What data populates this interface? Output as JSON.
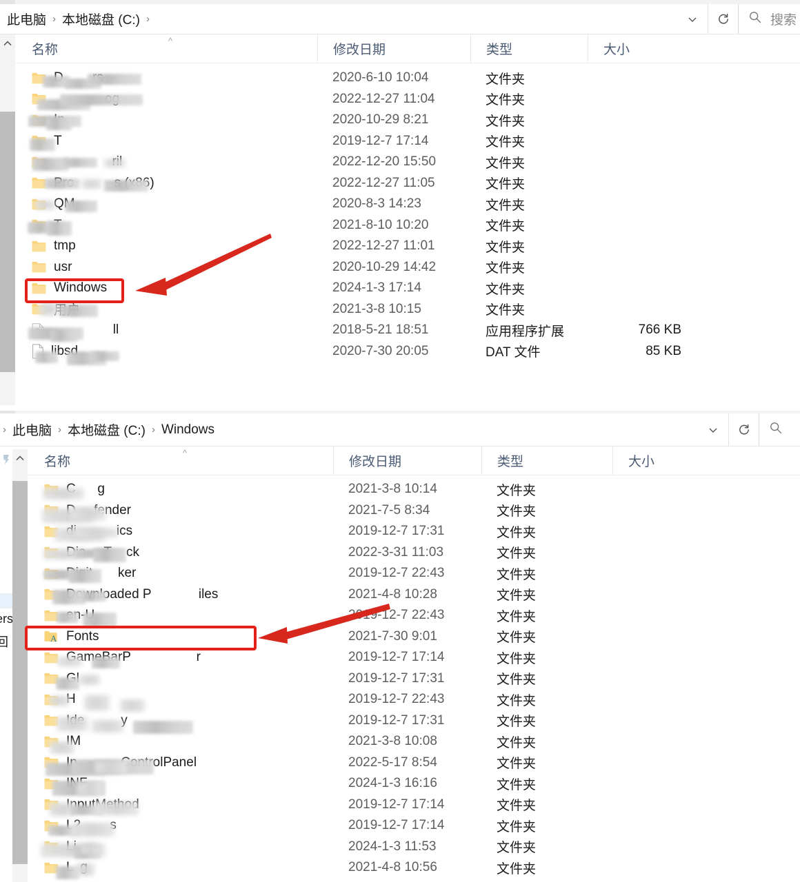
{
  "panel1": {
    "breadcrumb": {
      "items": [
        "此电脑",
        "本地磁盘 (C:)"
      ],
      "separator": "›",
      "leading_separator": ""
    },
    "toolbar": {
      "chevron": "⌄",
      "refresh": "↻"
    },
    "search": {
      "placeholder": "搜索",
      "icon": "search-icon"
    },
    "columns": [
      {
        "label": "名称",
        "key": "name"
      },
      {
        "label": "修改日期",
        "key": "date"
      },
      {
        "label": "类型",
        "key": "type"
      },
      {
        "label": "大小",
        "key": "size"
      }
    ],
    "sort_indicator": "^",
    "rows": [
      {
        "name": "D        rs",
        "icon": "folder",
        "date": "2020-6-10 10:04",
        "type": "文件夹",
        "size": "",
        "redacted": true
      },
      {
        "name": "              og",
        "icon": "folder",
        "date": "2022-12-27 11:04",
        "type": "文件夹",
        "size": "",
        "redacted": true
      },
      {
        "name": "In",
        "icon": "folder",
        "date": "2020-10-29 8:21",
        "type": "文件夹",
        "size": "",
        "redacted": true
      },
      {
        "name": "T",
        "icon": "folder",
        "date": "2019-12-7 17:14",
        "type": "文件夹",
        "size": "",
        "redacted": true
      },
      {
        "name": "                ril",
        "icon": "folder",
        "date": "2022-12-20 15:50",
        "type": "文件夹",
        "size": "",
        "redacted": true
      },
      {
        "name": "Pro           s (x86)",
        "icon": "folder",
        "date": "2022-12-27 11:05",
        "type": "文件夹",
        "size": "",
        "redacted": true
      },
      {
        "name": "QM",
        "icon": "folder",
        "date": "2020-8-3 14:23",
        "type": "文件夹",
        "size": "",
        "redacted": true
      },
      {
        "name": "T",
        "icon": "folder",
        "date": "2021-8-10 10:20",
        "type": "文件夹",
        "size": "",
        "redacted": true
      },
      {
        "name": "tmp",
        "icon": "folder",
        "date": "2022-12-27 11:01",
        "type": "文件夹",
        "size": "",
        "redacted": false
      },
      {
        "name": "usr",
        "icon": "folder",
        "date": "2020-10-29 14:42",
        "type": "文件夹",
        "size": "",
        "redacted": false
      },
      {
        "name": "Windows",
        "icon": "folder",
        "date": "2024-1-3 17:14",
        "type": "文件夹",
        "size": "",
        "redacted": false,
        "highlighted": true
      },
      {
        "name": "用户",
        "icon": "folder",
        "date": "2021-3-8 10:15",
        "type": "文件夹",
        "size": "",
        "redacted": true
      },
      {
        "name": "                 ll",
        "icon": "dll",
        "date": "2018-5-21 18:51",
        "type": "应用程序扩展",
        "size": "766 KB",
        "redacted": true
      },
      {
        "name": "libsd",
        "icon": "file",
        "date": "2020-7-30 20:05",
        "type": "DAT 文件",
        "size": "85 KB",
        "redacted": true
      }
    ],
    "annotation": {
      "box_target": "Windows",
      "arrow": "arrow-pointing-left"
    }
  },
  "panel2": {
    "breadcrumb": {
      "items": [
        "此电脑",
        "本地磁盘 (C:)",
        "Windows"
      ],
      "separator": "›",
      "leading_separator": "›"
    },
    "toolbar": {
      "chevron": "⌄",
      "refresh": "↻"
    },
    "search": {
      "placeholder": "",
      "icon": "search-icon"
    },
    "columns": [
      {
        "label": "名称",
        "key": "name"
      },
      {
        "label": "修改日期",
        "key": "date"
      },
      {
        "label": "类型",
        "key": "type"
      },
      {
        "label": "大小",
        "key": "size"
      }
    ],
    "sort_indicator": "^",
    "sidebar_fragments": [
      "ers",
      "回"
    ],
    "rows": [
      {
        "name": "C      g",
        "icon": "folder",
        "date": "2021-3-8 10:14",
        "type": "文件夹",
        "size": "",
        "redacted": true
      },
      {
        "name": "D     fender",
        "icon": "folder",
        "date": "2021-7-5 8:34",
        "type": "文件夹",
        "size": "",
        "redacted": true
      },
      {
        "name": "di           ics",
        "icon": "folder",
        "date": "2019-12-7 17:31",
        "type": "文件夹",
        "size": "",
        "redacted": true
      },
      {
        "name": "Dia     T    ck",
        "icon": "folder",
        "date": "2022-3-31 11:03",
        "type": "文件夹",
        "size": "",
        "redacted": true
      },
      {
        "name": "Digit       ker",
        "icon": "folder",
        "date": "2019-12-7 22:43",
        "type": "文件夹",
        "size": "",
        "redacted": true
      },
      {
        "name": "Downloaded P             iles",
        "icon": "folder",
        "date": "2021-4-8 10:28",
        "type": "文件夹",
        "size": "",
        "redacted": true
      },
      {
        "name": "en-U",
        "icon": "folder",
        "date": "2019-12-7 22:43",
        "type": "文件夹",
        "size": "",
        "redacted": true
      },
      {
        "name": "Fonts",
        "icon": "fonts",
        "date": "2021-7-30 9:01",
        "type": "文件夹",
        "size": "",
        "redacted": false,
        "highlighted": true
      },
      {
        "name": "GameBarP                  r",
        "icon": "folder",
        "date": "2019-12-7 17:14",
        "type": "文件夹",
        "size": "",
        "redacted": true
      },
      {
        "name": "Gl",
        "icon": "folder",
        "date": "2019-12-7 17:31",
        "type": "文件夹",
        "size": "",
        "redacted": true
      },
      {
        "name": "H",
        "icon": "folder",
        "date": "2019-12-7 22:43",
        "type": "文件夹",
        "size": "",
        "redacted": true
      },
      {
        "name": "Ide          y",
        "icon": "folder",
        "date": "2019-12-7 17:31",
        "type": "文件夹",
        "size": "",
        "redacted": true
      },
      {
        "name": "IM",
        "icon": "folder",
        "date": "2021-3-8 10:08",
        "type": "文件夹",
        "size": "",
        "redacted": true
      },
      {
        "name": "In            ControlPanel",
        "icon": "folder",
        "date": "2022-5-17 8:54",
        "type": "文件夹",
        "size": "",
        "redacted": true
      },
      {
        "name": "INF",
        "icon": "folder",
        "date": "2024-1-3 16:16",
        "type": "文件夹",
        "size": "",
        "redacted": true
      },
      {
        "name": "InputMethod",
        "icon": "folder",
        "date": "2019-12-7 17:14",
        "type": "文件夹",
        "size": "",
        "redacted": true
      },
      {
        "name": "L2        s",
        "icon": "folder",
        "date": "2019-12-7 17:14",
        "type": "文件夹",
        "size": "",
        "redacted": true
      },
      {
        "name": "Li                 ",
        "icon": "folder",
        "date": "2024-1-3 11:53",
        "type": "文件夹",
        "size": "",
        "redacted": true
      },
      {
        "name": "L  g",
        "icon": "folder",
        "date": "2021-4-8 10:56",
        "type": "文件夹",
        "size": "",
        "redacted": true
      }
    ],
    "annotation": {
      "box_target": "Fonts",
      "arrow": "arrow-pointing-left"
    }
  },
  "colors": {
    "annotation_red": "#e32119",
    "folder_yellow": "#f8d278",
    "header_text": "#4a5a73",
    "fonts_letter_blue": "#2f7f8f"
  }
}
